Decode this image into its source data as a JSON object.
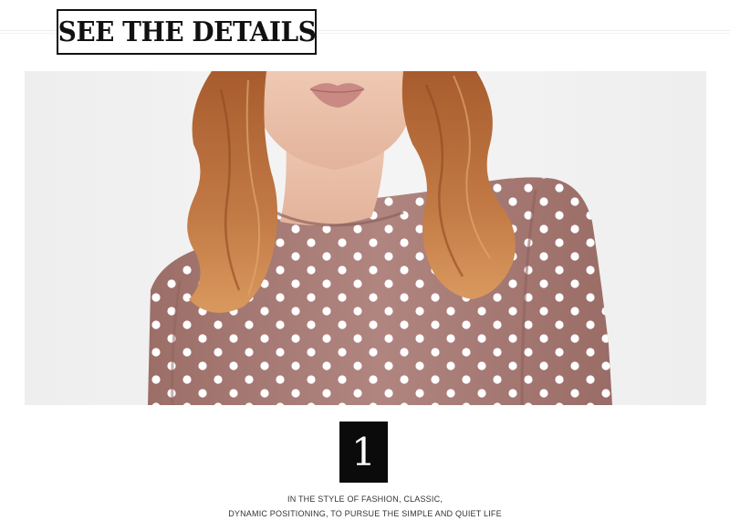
{
  "header": {
    "title": "SEE THE DETAILS"
  },
  "hero_image": {
    "subject": "woman-polka-dot-top"
  },
  "feature": {
    "number": "1",
    "caption_line1": "IN THE STYLE OF FASHION, CLASSIC,",
    "caption_line2": "DYNAMIC POSITIONING, TO PURSUE THE SIMPLE AND QUIET LIFE"
  },
  "colors": {
    "background": "#ffffff",
    "photo_background": "#f2f2f2",
    "fabric": "#a87a74",
    "dots": "#ffffff",
    "hair": "#b86a3a",
    "skin": "#ecc3ab",
    "badge": "#0b0b0b"
  }
}
